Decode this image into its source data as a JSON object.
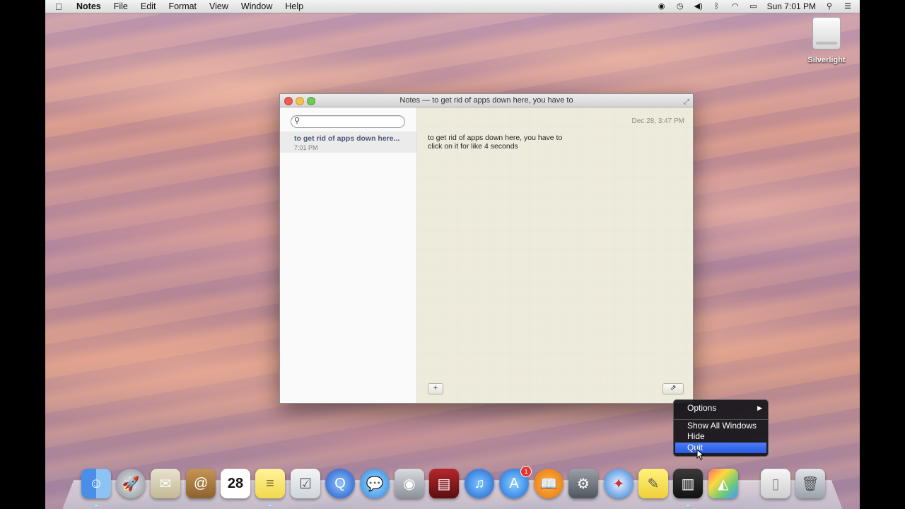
{
  "menubar": {
    "app": "Notes",
    "items": [
      "File",
      "Edit",
      "Format",
      "View",
      "Window",
      "Help"
    ],
    "clock": "Sun 7:01 PM"
  },
  "desktop": {
    "disk_label": "Silverlight"
  },
  "window": {
    "title": "Notes — to get rid of apps down here, you have to",
    "search_placeholder": "",
    "note_item": {
      "title": "to get rid of apps down here...",
      "time": "7:01 PM"
    },
    "note": {
      "date": "Dec 28, 3:47 PM",
      "line1": "to get rid of apps down here, you have to",
      "line2": "click on it for like 4 seconds"
    },
    "add_label": "+",
    "share_label": "⇗"
  },
  "context_menu": {
    "items": [
      "Options",
      "Show All Windows",
      "Hide",
      "Quit"
    ],
    "selected": "Quit"
  },
  "dock": {
    "calendar_day": "28",
    "appstore_badge": "1"
  },
  "colors": {
    "selection": "#2659e4"
  }
}
